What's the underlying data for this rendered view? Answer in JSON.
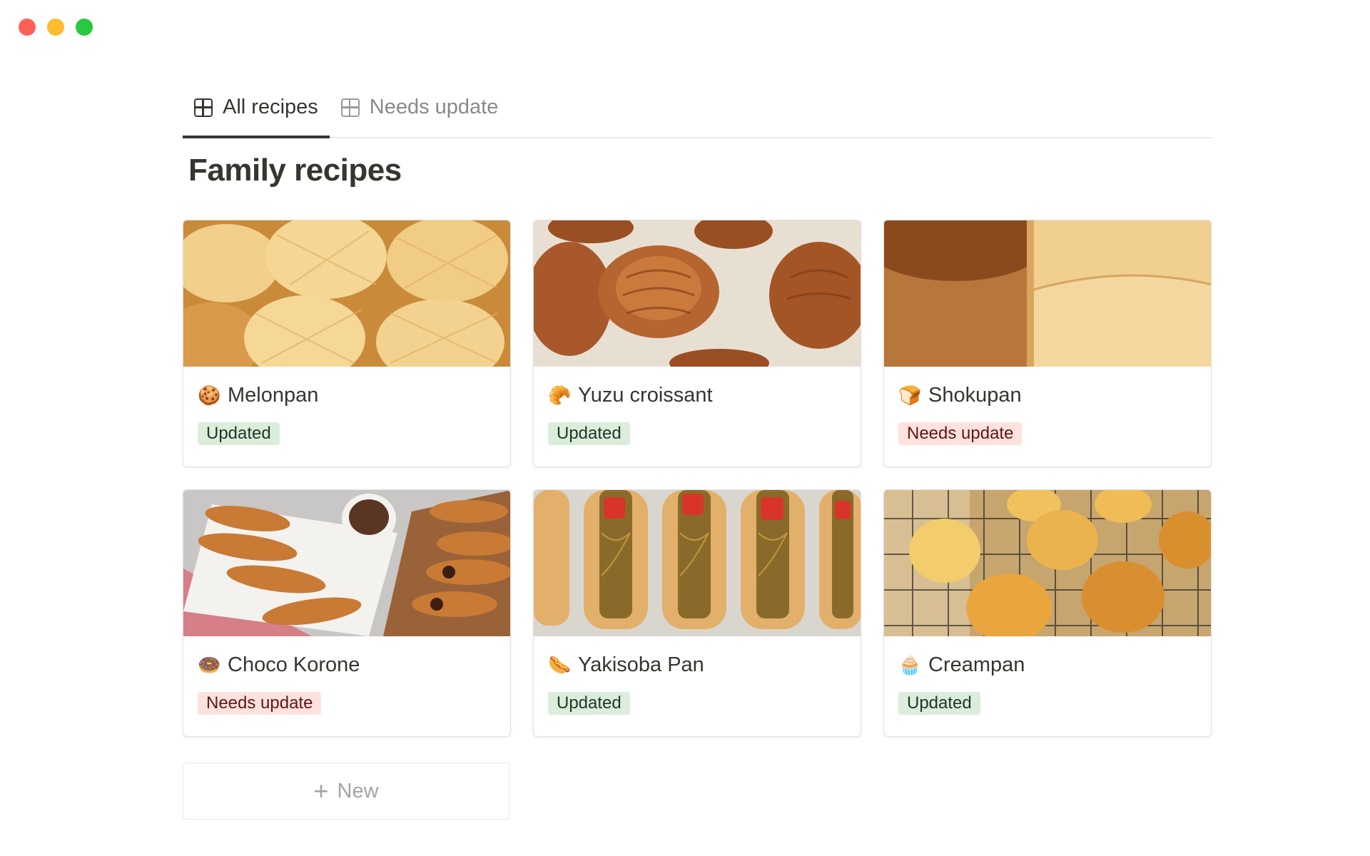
{
  "window": {
    "controls": [
      {
        "name": "close",
        "color": "#ff5f57"
      },
      {
        "name": "minimize",
        "color": "#febc2e"
      },
      {
        "name": "maximize",
        "color": "#28c840"
      }
    ]
  },
  "tabs": [
    {
      "label": "All recipes",
      "icon": "table-icon",
      "active": true
    },
    {
      "label": "Needs update",
      "icon": "table-icon",
      "active": false
    }
  ],
  "page": {
    "title": "Family recipes"
  },
  "cards": [
    {
      "title": "Melonpan",
      "emoji": "🍪",
      "status": "Updated"
    },
    {
      "title": "Yuzu croissant",
      "emoji": "🥐",
      "status": "Updated"
    },
    {
      "title": "Shokupan",
      "emoji": "🍞",
      "status": "Needs update"
    },
    {
      "title": "Choco Korone",
      "emoji": "🍩",
      "status": "Needs update"
    },
    {
      "title": "Yakisoba Pan",
      "emoji": "🌭",
      "status": "Updated"
    },
    {
      "title": "Creampan",
      "emoji": "🧁",
      "status": "Updated"
    }
  ],
  "new_button": {
    "label": "New",
    "icon": "plus-icon"
  },
  "colors": {
    "updated_bg": "#dbeddb",
    "updated_text": "#1c3829",
    "needs_bg": "#ffe2dd",
    "needs_text": "#5d1715",
    "text_primary": "#37352f",
    "text_muted": "#8a8986"
  }
}
